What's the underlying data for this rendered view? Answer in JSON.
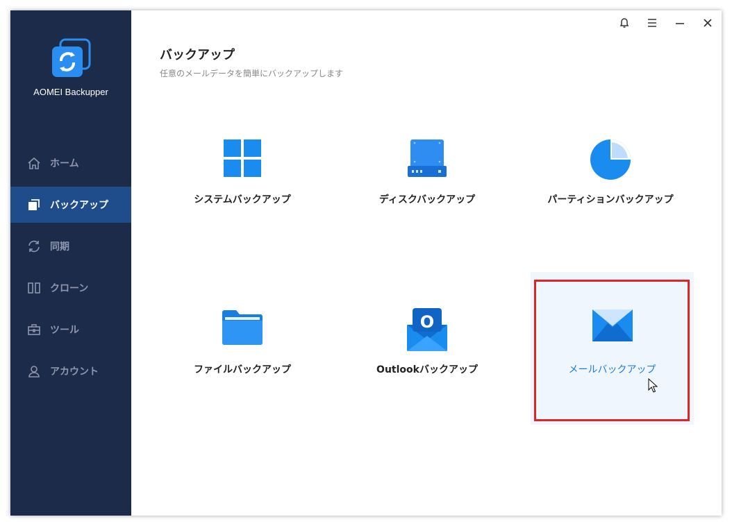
{
  "app": {
    "name": "AOMEI Backupper"
  },
  "sidebar": {
    "items": [
      {
        "label": "ホーム",
        "icon": "home-icon",
        "active": false
      },
      {
        "label": "バックアップ",
        "icon": "copy-icon",
        "active": true
      },
      {
        "label": "同期",
        "icon": "sync-icon",
        "active": false
      },
      {
        "label": "クローン",
        "icon": "clone-icon",
        "active": false
      },
      {
        "label": "ツール",
        "icon": "toolbox-icon",
        "active": false
      },
      {
        "label": "アカウント",
        "icon": "user-icon",
        "active": false
      }
    ]
  },
  "titlebar": {
    "icons": [
      "bell-icon",
      "menu-icon",
      "minimize-icon",
      "close-icon"
    ]
  },
  "main": {
    "title": "バックアップ",
    "subtitle": "任意のメールデータを簡単にバックアップします",
    "tiles": [
      {
        "label": "システムバックアップ",
        "icon": "windows-icon"
      },
      {
        "label": "ディスクバックアップ",
        "icon": "disk-icon"
      },
      {
        "label": "パーティションバックアップ",
        "icon": "partition-pie-icon"
      },
      {
        "label": "ファイルバックアップ",
        "icon": "folder-icon"
      },
      {
        "label": "Outlookバックアップ",
        "icon": "outlook-icon"
      },
      {
        "label": "メールバックアップ",
        "icon": "mail-icon",
        "selected": true
      }
    ]
  },
  "colors": {
    "sidebar_bg": "#1d2b4b",
    "sidebar_active": "#1f4d8c",
    "accent": "#1d7be0",
    "highlight_border": "#e02323"
  }
}
